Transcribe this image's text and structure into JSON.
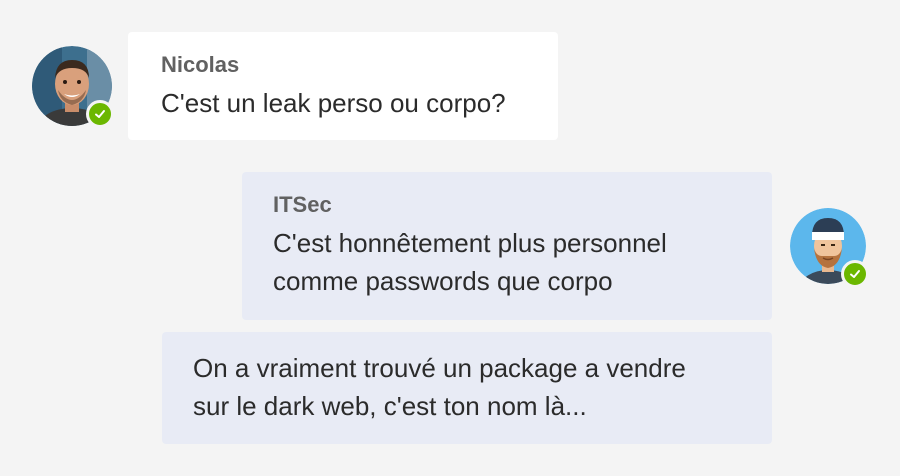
{
  "messages": [
    {
      "sender": "Nicolas",
      "text": "C'est un leak perso ou corpo?",
      "direction": "incoming",
      "presence": "available"
    },
    {
      "sender": "ITSec",
      "text": "C'est honnêtement plus personnel\ncomme passwords que corpo",
      "direction": "outgoing",
      "presence": "available"
    },
    {
      "sender": "",
      "text": "On a vraiment trouvé un package a vendre\nsur le dark web, c'est ton nom là...",
      "direction": "outgoing"
    }
  ],
  "colors": {
    "background": "#f4f4f4",
    "incoming_bubble": "#ffffff",
    "outgoing_bubble": "#e8ebf5",
    "presence_available": "#6bb700"
  }
}
